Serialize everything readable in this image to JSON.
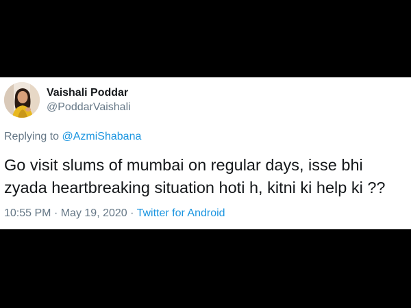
{
  "tweet": {
    "author": {
      "name": "Vaishali Poddar",
      "handle": "@PoddarVaishali",
      "avatar_icon": "profile-photo"
    },
    "reply": {
      "prefix": "Replying to",
      "mention": "@AzmiShabana"
    },
    "text": "Go visit slums of mumbai on regular days, isse bhi zyada heartbreaking situation hoti h, kitni ki help ki ??",
    "time": "10:55 PM",
    "separator": "·",
    "date": "May 19, 2020",
    "source": "Twitter for Android"
  },
  "colors": {
    "background": "#000000",
    "card": "#ffffff",
    "text": "#14171a",
    "muted": "#657786",
    "link": "#1b95e0"
  }
}
